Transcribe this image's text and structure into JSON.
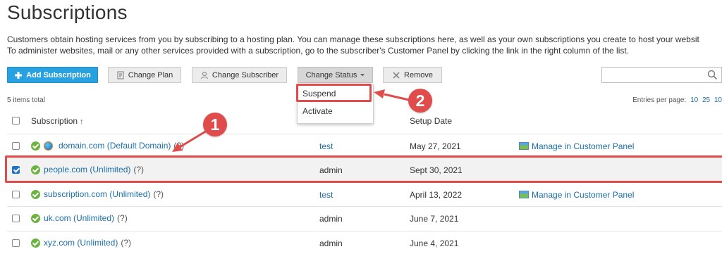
{
  "page": {
    "title": "Subscriptions",
    "description": [
      "Customers obtain hosting services from you by subscribing to a hosting plan. You can manage these subscriptions here, as well as your own subscriptions you create to host your websit",
      "To administer websites, mail or any other services provided with a subscription, go to the subscriber's Customer Panel by clicking the link in the right column of the list."
    ]
  },
  "toolbar": {
    "add_subscription": "Add Subscription",
    "change_plan": "Change Plan",
    "change_subscriber": "Change Subscriber",
    "change_status": "Change Status",
    "remove": "Remove",
    "search_placeholder": ""
  },
  "status_menu": {
    "items": [
      "Suspend",
      "Activate"
    ]
  },
  "list": {
    "items_total": "5 items total",
    "per_page_label": "Entries per page:",
    "per_page_options": [
      "10",
      "25",
      "10"
    ],
    "columns": {
      "subscription": "Subscription",
      "subscriber": "",
      "setup_date": "Setup Date",
      "actions": ""
    },
    "rows": [
      {
        "subscription": "domain.com (Default Domain)",
        "help": "(?)",
        "subscriber": "test",
        "subscriber_link": true,
        "setup_date": "May 27, 2021",
        "action": "Manage in Customer Panel",
        "checked": false,
        "default_domain": true
      },
      {
        "subscription": "people.com (Unlimited)",
        "help": "(?)",
        "subscriber": "admin",
        "subscriber_link": false,
        "setup_date": "Sept 30, 2021",
        "action": "",
        "checked": true,
        "default_domain": false
      },
      {
        "subscription": "subscription.com (Unlimited)",
        "help": "(?)",
        "subscriber": "test",
        "subscriber_link": true,
        "setup_date": "April 13, 2022",
        "action": "Manage in Customer Panel",
        "checked": false,
        "default_domain": false
      },
      {
        "subscription": "uk.com (Unlimited)",
        "help": "(?)",
        "subscriber": "admin",
        "subscriber_link": false,
        "setup_date": "June 7, 2021",
        "action": "",
        "checked": false,
        "default_domain": false
      },
      {
        "subscription": "xyz.com (Unlimited)",
        "help": "(?)",
        "subscriber": "admin",
        "subscriber_link": false,
        "setup_date": "June 4, 2021",
        "action": "",
        "checked": false,
        "default_domain": false
      }
    ]
  },
  "annotations": {
    "callout_1": "1",
    "callout_2": "2",
    "color": "#e04b4b"
  },
  "colors": {
    "primary": "#28a1e0",
    "link": "#1b6fa8",
    "success": "#6cb33f"
  }
}
